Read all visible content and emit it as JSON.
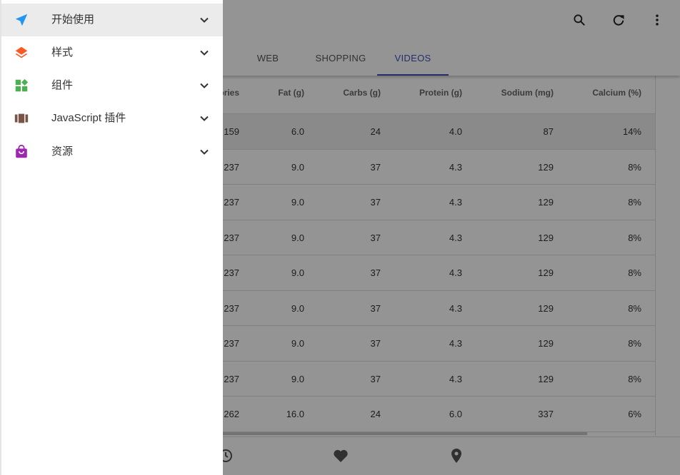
{
  "drawer": {
    "items": [
      {
        "label": "开始使用",
        "icon": "send-icon",
        "color": "#2196f3"
      },
      {
        "label": "样式",
        "icon": "layers-icon",
        "color": "#ff5722"
      },
      {
        "label": "组件",
        "icon": "widgets-icon",
        "color": "#4caf50"
      },
      {
        "label": "JavaScript 插件",
        "icon": "view-array-icon",
        "color": "#795548"
      },
      {
        "label": "资源",
        "icon": "shopping-bag-icon",
        "color": "#9c27b0"
      }
    ]
  },
  "toolbar": {
    "actions": [
      "search-icon",
      "refresh-icon",
      "more-vert-icon"
    ]
  },
  "tabs": {
    "items": [
      "WEB",
      "SHOPPING",
      "VIDEOS"
    ],
    "active": "VIDEOS",
    "accent": "#3f51b5"
  },
  "table": {
    "headers": [
      "ories",
      "Fat (g)",
      "Carbs (g)",
      "Protein (g)",
      "Sodium (mg)",
      "Calcium (%)"
    ],
    "rows": [
      [
        "159",
        "6.0",
        "24",
        "4.0",
        "87",
        "14%"
      ],
      [
        "237",
        "9.0",
        "37",
        "4.3",
        "129",
        "8%"
      ],
      [
        "237",
        "9.0",
        "37",
        "4.3",
        "129",
        "8%"
      ],
      [
        "237",
        "9.0",
        "37",
        "4.3",
        "129",
        "8%"
      ],
      [
        "237",
        "9.0",
        "37",
        "4.3",
        "129",
        "8%"
      ],
      [
        "237",
        "9.0",
        "37",
        "4.3",
        "129",
        "8%"
      ],
      [
        "237",
        "9.0",
        "37",
        "4.3",
        "129",
        "8%"
      ],
      [
        "237",
        "9.0",
        "37",
        "4.3",
        "129",
        "8%"
      ],
      [
        "262",
        "16.0",
        "24",
        "6.0",
        "337",
        "6%"
      ]
    ]
  },
  "bottom_nav": {
    "items": [
      "history-icon",
      "favorite-icon",
      "place-icon"
    ]
  }
}
